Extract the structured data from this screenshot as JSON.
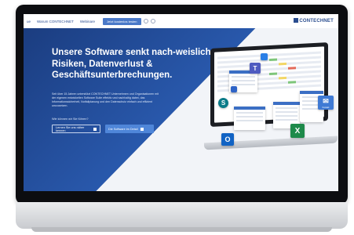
{
  "nav": {
    "items": [
      "ue",
      "Warum CONTECHNET",
      "Webinare"
    ],
    "cta_label": "Jetzt kostenlos testen",
    "logo_text": "CONTECHNET"
  },
  "hero": {
    "title": "Unsere Software senkt nach-weislich Risiken, Datenverlust & Geschäftsunterbrechungen.",
    "body": "Seit über 15 Jahren unterstützt CONTECHNET Unternehmen und Organisationen mit der eigenen entwickelten Software Suite effektiv und nachhaltig dabei, das Informationssicherheit, Notfallplanung und den Datenschutz einfach und effizient umzusetzen.",
    "question": "Wie können wir Sie führen?",
    "button_primary": "Lernen Sie uns näher kennen",
    "button_secondary": "Die Software im Detail"
  },
  "tiles": {
    "excel": "X",
    "outlook": "O",
    "sharepoint": "S",
    "teams": "T",
    "mail_label": "Kontakt"
  },
  "colors": {
    "hero_blue": "#1d3f86",
    "accent": "#4f86d9",
    "excel_green": "#1e8a4a"
  }
}
